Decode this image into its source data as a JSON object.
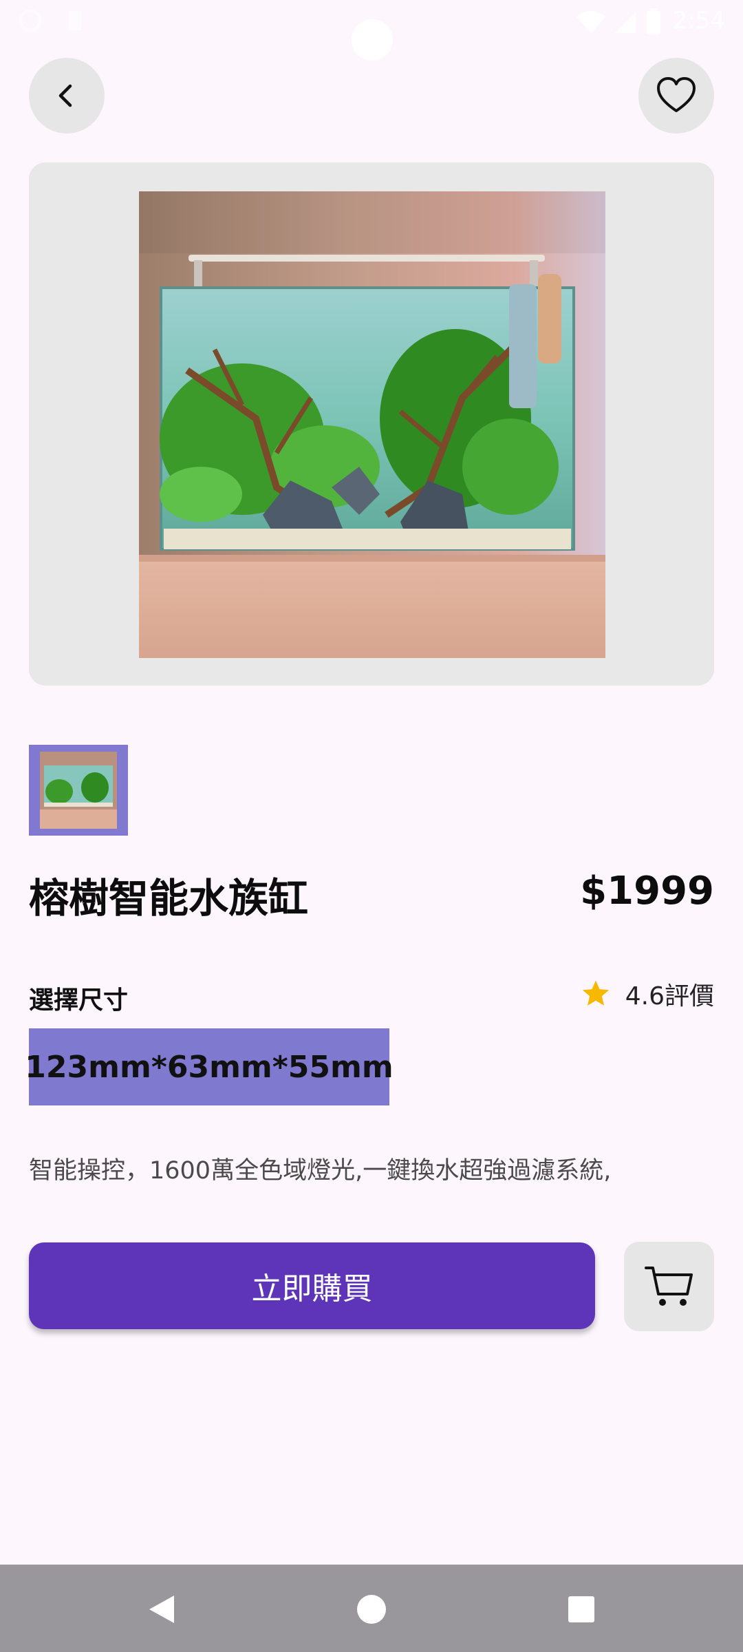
{
  "status_bar": {
    "time": "2:54"
  },
  "header": {
    "back_icon": "chevron-left-icon",
    "favorite_icon": "heart-outline-icon"
  },
  "product": {
    "name": "榕樹智能水族缸",
    "price": "$1999",
    "size_label": "選擇尺寸",
    "size_option": "123mm*63mm*55mm",
    "rating_text": "4.6評價",
    "description": "智能操控，1600萬全色域燈光,一鍵換水超強過濾系統,"
  },
  "actions": {
    "buy_label": "立即購買",
    "cart_icon": "shopping-cart-icon"
  },
  "colors": {
    "background": "#FDF7FD",
    "primary": "#5E35B8",
    "selected_size": "#7F79CF",
    "star": "#F6B900",
    "button_bg": "#E6E6E6",
    "nav_bar": "#9A979C"
  }
}
